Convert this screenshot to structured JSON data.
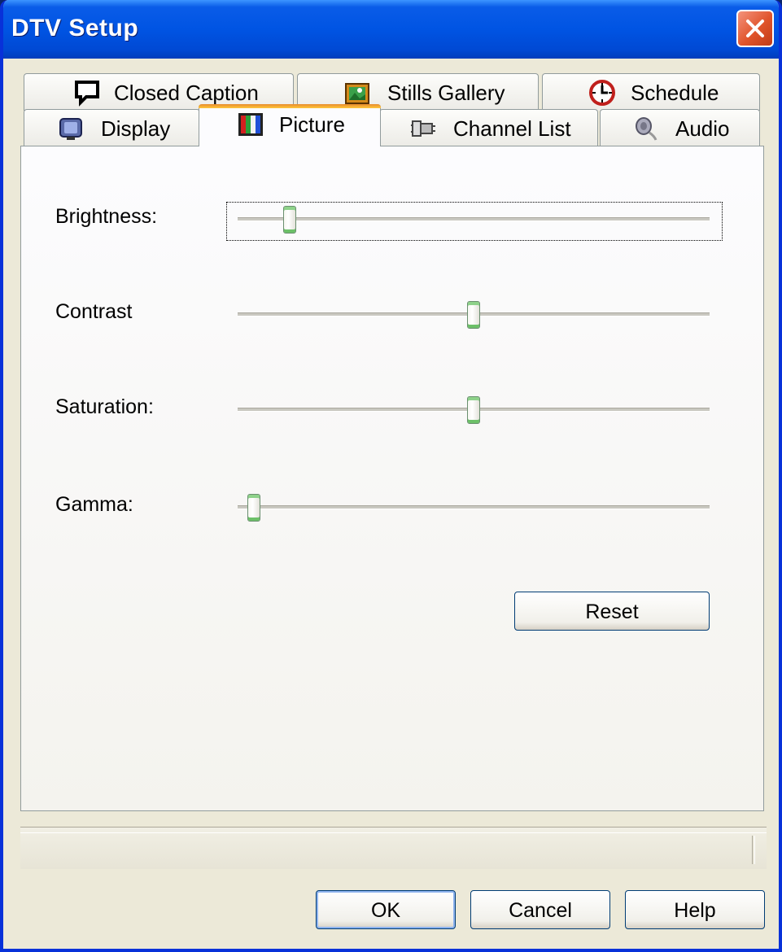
{
  "window": {
    "title": "DTV Setup"
  },
  "tabs_back": [
    {
      "label": "Closed Caption",
      "icon": "caption-icon"
    },
    {
      "label": "Stills Gallery",
      "icon": "gallery-icon"
    },
    {
      "label": "Schedule",
      "icon": "schedule-icon"
    }
  ],
  "tabs_front": [
    {
      "label": "Display",
      "icon": "display-icon"
    },
    {
      "label": "Picture",
      "icon": "picture-icon",
      "active": true
    },
    {
      "label": "Channel List",
      "icon": "channel-list-icon"
    },
    {
      "label": "Audio",
      "icon": "audio-icon"
    }
  ],
  "sliders": [
    {
      "label": "Brightness:",
      "value": 0.09
    },
    {
      "label": "Contrast",
      "value": 0.5
    },
    {
      "label": "Saturation:",
      "value": 0.5
    },
    {
      "label": "Gamma:",
      "value": 0.01
    }
  ],
  "buttons": {
    "reset": "Reset",
    "ok": "OK",
    "cancel": "Cancel",
    "help": "Help"
  },
  "colors": {
    "title_bar": "#0054e3",
    "active_tab_accent": "#e68b2c",
    "slider_thumb": "#6cc068"
  }
}
